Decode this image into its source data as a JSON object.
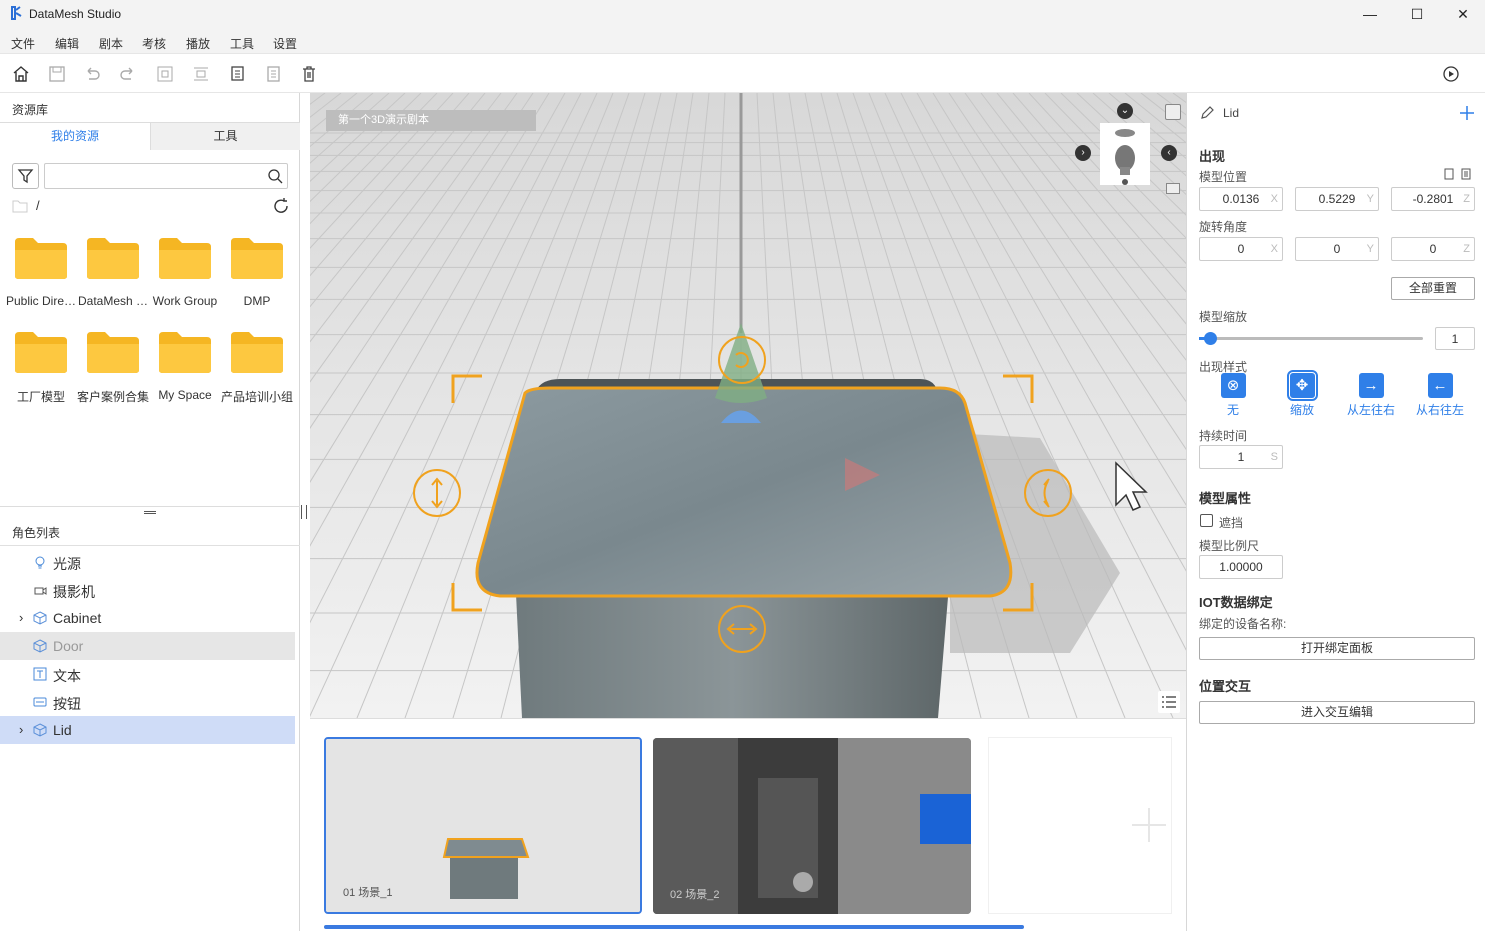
{
  "window": {
    "title": "DataMesh Studio",
    "minimize": "—",
    "maximize": "☐",
    "close": "✕"
  },
  "menu": [
    "文件",
    "编辑",
    "剧本",
    "考核",
    "播放",
    "工具",
    "设置"
  ],
  "resource": {
    "title": "资源库",
    "tabs": [
      "我的资源",
      "工具"
    ],
    "path": "/",
    "folders": [
      "Public Dire…",
      "DataMesh …",
      "Work Group",
      "DMP",
      "工厂模型",
      "客户案例合集",
      "My Space",
      "产品培训小组"
    ]
  },
  "roles": {
    "title": "角色列表",
    "items": [
      {
        "label": "光源",
        "icon": "bulb-icon"
      },
      {
        "label": "摄影机",
        "icon": "camera-icon"
      },
      {
        "label": "Cabinet",
        "icon": "cube-icon",
        "expandable": true
      },
      {
        "label": "Door",
        "icon": "cube-icon",
        "hidden": true
      },
      {
        "label": "文本",
        "icon": "text-icon"
      },
      {
        "label": "按钮",
        "icon": "button-icon"
      },
      {
        "label": "Lid",
        "icon": "cube-icon",
        "expandable": true,
        "selected": true
      }
    ]
  },
  "viewport": {
    "scene_label": "第一个3D演示剧本"
  },
  "scenes": [
    {
      "label": "01   场景_1",
      "selected": true
    },
    {
      "label": "02   场景_2",
      "selected": false
    }
  ],
  "props": {
    "object_name": "Lid",
    "appear_section": "出现",
    "position_label": "模型位置",
    "position": {
      "x": "0.0136",
      "y": "0.5229",
      "z": "-0.2801"
    },
    "rotation_label": "旋转角度",
    "rotation": {
      "x": "0",
      "y": "0",
      "z": "0"
    },
    "reset_all": "全部重置",
    "scale_label": "模型缩放",
    "scale_value": "1",
    "scale_fraction": 0.05,
    "appear_style_label": "出现样式",
    "styles": [
      {
        "label": "无",
        "icon": "circle-x-icon"
      },
      {
        "label": "缩放",
        "icon": "scale-icon",
        "selected": true
      },
      {
        "label": "从左往右",
        "icon": "arrow-right-icon"
      },
      {
        "label": "从右往左",
        "icon": "arrow-left-icon"
      }
    ],
    "duration_label": "持续时间",
    "duration_value": "1",
    "duration_unit": "S",
    "model_attr_section": "模型属性",
    "occlude_label": "遮挡",
    "model_scale_label": "模型比例尺",
    "model_scale_value": "1.00000",
    "iot_section": "IOT数据绑定",
    "iot_device_label": "绑定的设备名称:",
    "iot_button": "打开绑定面板",
    "interact_section": "位置交互",
    "interact_button": "进入交互编辑",
    "axes": {
      "x": "X",
      "y": "Y",
      "z": "Z"
    }
  },
  "colors": {
    "accent": "#2f7fe8",
    "gizmo": "#f0a21e",
    "folder": "#fbc02d",
    "selected_row": "#cfdcf7"
  }
}
